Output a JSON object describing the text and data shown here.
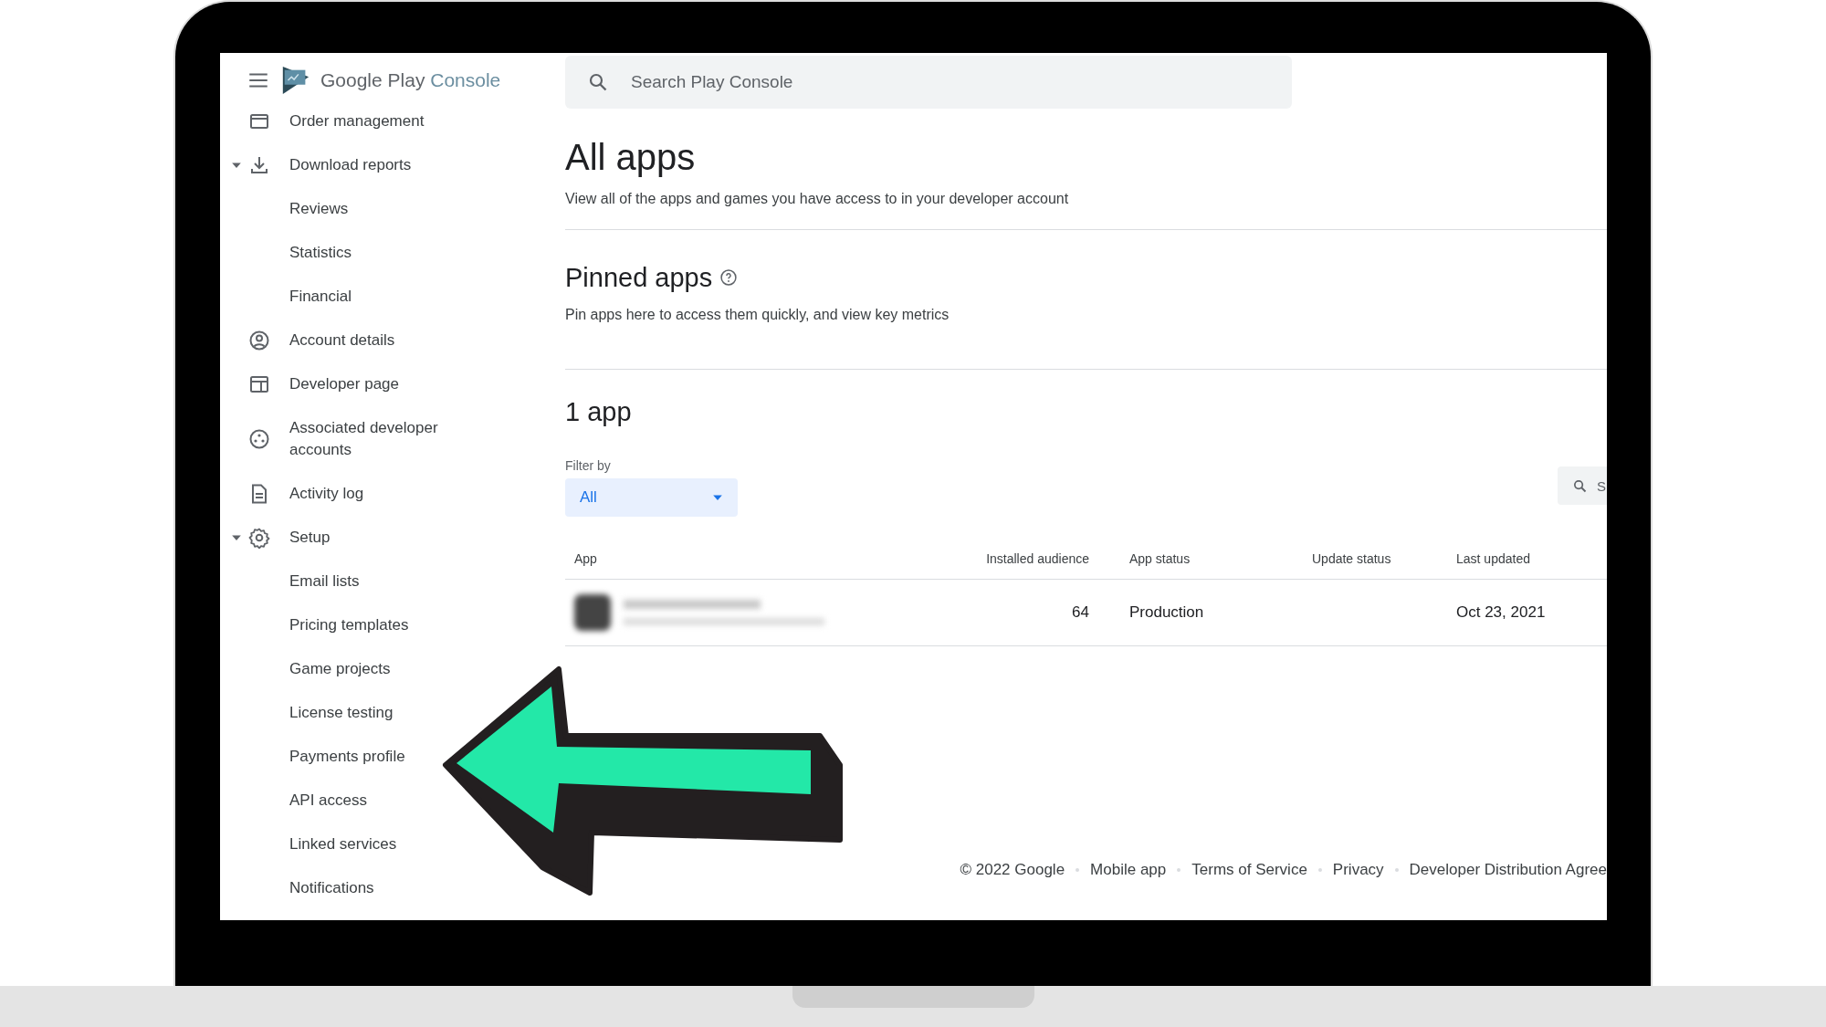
{
  "header": {
    "brand": "Google Play",
    "product": "Console"
  },
  "search": {
    "placeholder": "Search Play Console"
  },
  "sidebar": {
    "items": [
      {
        "label": "Order management"
      },
      {
        "label": "Download reports",
        "expanded": true,
        "children": [
          {
            "label": "Reviews"
          },
          {
            "label": "Statistics"
          },
          {
            "label": "Financial"
          }
        ]
      },
      {
        "label": "Account details"
      },
      {
        "label": "Developer page"
      },
      {
        "label": "Associated developer accounts"
      },
      {
        "label": "Activity log"
      },
      {
        "label": "Setup",
        "expanded": true,
        "children": [
          {
            "label": "Email lists"
          },
          {
            "label": "Pricing templates"
          },
          {
            "label": "Game projects"
          },
          {
            "label": "License testing"
          },
          {
            "label": "Payments profile"
          },
          {
            "label": "API access"
          },
          {
            "label": "Linked services"
          },
          {
            "label": "Notifications"
          }
        ]
      }
    ]
  },
  "page": {
    "title": "All apps",
    "subtitle": "View all of the apps and games you have access to in your developer account"
  },
  "pinned": {
    "title": "Pinned apps",
    "subtitle": "Pin apps here to access them quickly, and view key metrics"
  },
  "apps": {
    "count_label": "1 app",
    "filter": {
      "label": "Filter by",
      "value": "All"
    },
    "search": {
      "placeholder": "S"
    },
    "table": {
      "columns": [
        "App",
        "Installed audience",
        "App status",
        "Update status",
        "Last updated"
      ],
      "rows": [
        {
          "installed_audience": "64",
          "app_status": "Production",
          "last_updated": "Oct 23, 2021"
        }
      ]
    }
  },
  "footer": {
    "copyright": "© 2022 Google",
    "links": [
      "Mobile app",
      "Terms of Service",
      "Privacy",
      "Developer Distribution Agree"
    ]
  }
}
